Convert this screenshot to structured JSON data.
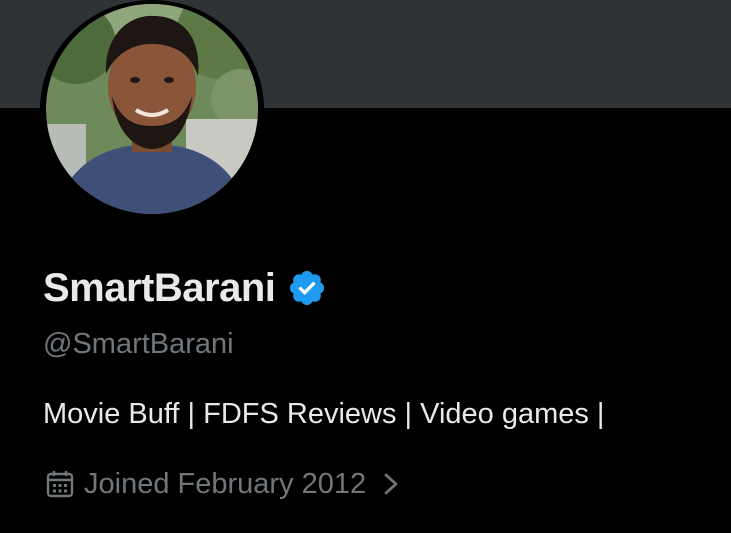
{
  "profile": {
    "display_name": "SmartBarani",
    "handle": "@SmartBarani",
    "bio": "Movie Buff | FDFS Reviews | Video games |",
    "joined": "Joined February 2012",
    "verified": true
  },
  "icons": {
    "verified": "verified-badge-icon",
    "calendar": "calendar-icon",
    "chevron": "chevron-right-icon"
  },
  "colors": {
    "background": "#000000",
    "banner": "#2f3336",
    "primary_text": "#e7e9ea",
    "secondary_text": "#71767b",
    "verified_blue": "#1d9bf0"
  }
}
